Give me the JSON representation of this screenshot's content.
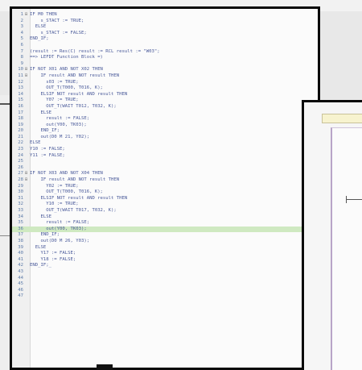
{
  "editor": {
    "lines": [
      {
        "n": "1",
        "t": "IF M0 THEN"
      },
      {
        "n": "2",
        "t": "    s_STACT := TRUE;"
      },
      {
        "n": "3",
        "t": "  ELSE"
      },
      {
        "n": "4",
        "t": "    s_STACT := FALSE;"
      },
      {
        "n": "5",
        "t": "END_IF;"
      },
      {
        "n": "6",
        "t": ""
      },
      {
        "n": "7",
        "t": "(result := Res(C) result := RCL result := \"W03\";"
      },
      {
        "n": "8",
        "t": "==> LEFDT Function Block =)"
      },
      {
        "n": "9",
        "t": ""
      },
      {
        "n": "10",
        "t": "IF NOT X01 AND NOT X02 THEN"
      },
      {
        "n": "11",
        "t": "    IF result AND NOT result THEN"
      },
      {
        "n": "12",
        "t": "      s03 := TRUE;"
      },
      {
        "n": "13",
        "t": "      OUT_T(T000, T016, K);"
      },
      {
        "n": "14",
        "t": "    ELSIF NOT result AND result THEN"
      },
      {
        "n": "15",
        "t": "      Y07 := TRUE;"
      },
      {
        "n": "16",
        "t": "      OUT_T(WAIT T012, T032, K);"
      },
      {
        "n": "17",
        "t": "    ELSE"
      },
      {
        "n": "18",
        "t": "      result := FALSE;"
      },
      {
        "n": "19",
        "t": "      out(Y00, TK03);"
      },
      {
        "n": "20",
        "t": "    END_IF;"
      },
      {
        "n": "21",
        "t": "    out(D0 M 21, Y02);"
      },
      {
        "n": "22",
        "t": "ELSE"
      },
      {
        "n": "23",
        "t": "Y10 := FALSE;"
      },
      {
        "n": "24",
        "t": "Y11 := FALSE;"
      },
      {
        "n": "25",
        "t": ""
      },
      {
        "n": "26",
        "t": ""
      },
      {
        "n": "27",
        "t": "IF NOT X03 AND NOT X04 THEN"
      },
      {
        "n": "28",
        "t": "    IF result AND NOT result THEN"
      },
      {
        "n": "29",
        "t": "      Y02 := TRUE;"
      },
      {
        "n": "30",
        "t": "      OUT_T(T000, T016, K);"
      },
      {
        "n": "31",
        "t": "    ELSIF NOT result AND result THEN"
      },
      {
        "n": "32",
        "t": "      Y10 := TRUE;"
      },
      {
        "n": "33",
        "t": "      OUT_T(WAIT T017, T032, K);"
      },
      {
        "n": "34",
        "t": "    ELSE"
      },
      {
        "n": "35",
        "t": "      result := FALSE;"
      },
      {
        "n": "36",
        "t": "      out(Y00, TK03);",
        "highlight": true
      },
      {
        "n": "37",
        "t": "    END_IF;"
      },
      {
        "n": "38",
        "t": "    out(D0 M 26, Y03);"
      },
      {
        "n": "39",
        "t": "  ELSE"
      },
      {
        "n": "40",
        "t": "    Y17 := FALSE;"
      },
      {
        "n": "41",
        "t": "    Y18 := FALSE;"
      },
      {
        "n": "42",
        "t": "END_IF;_"
      },
      {
        "n": "43",
        "t": ""
      },
      {
        "n": "44",
        "t": ""
      },
      {
        "n": "45",
        "t": ""
      },
      {
        "n": "46",
        "t": ""
      },
      {
        "n": "47",
        "t": ""
      }
    ]
  },
  "colors": {
    "highlight": "#cfe9c1",
    "keyword": "#3a4fb0",
    "window_border": "#0a0a0a",
    "diagram_toolbar": "#f7f3cf"
  }
}
